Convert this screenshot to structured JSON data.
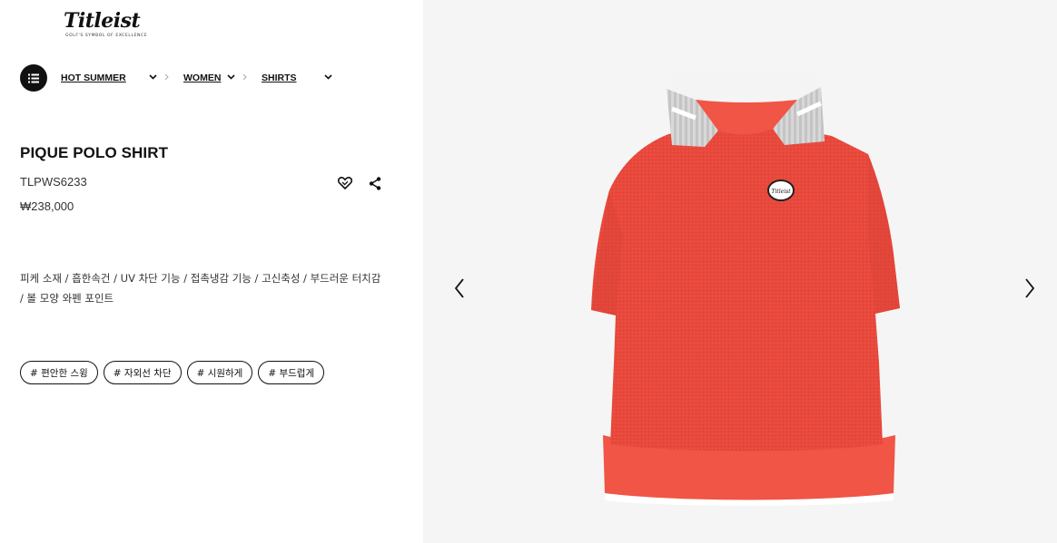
{
  "brand": {
    "name": "Titleist",
    "tagline": "GOLF'S SYMBOL OF EXCELLENCE"
  },
  "breadcrumb": {
    "items": [
      {
        "label": "HOT SUMMER"
      },
      {
        "label": "WOMEN"
      },
      {
        "label": "SHIRTS"
      }
    ]
  },
  "product": {
    "title": "PIQUE POLO SHIRT",
    "code": "TLPWS6233",
    "price": "₩238,000",
    "description": "피케 소재 / 흡한속건 / UV 차단 기능 / 접촉냉감 기능 / 고신축성 / 부드러운 터치감 / 볼 모양 와펜 포인트",
    "tags": [
      "# 편안한 스윙",
      "# 자외선 차단",
      "# 시원하게",
      "# 부드럽게"
    ],
    "color": "#e8493c",
    "patch_text": "Titleist"
  },
  "icons": {
    "menu": "menu-list-icon",
    "wishlist": "heart-icon",
    "share": "share-icon",
    "prev": "chevron-left-icon",
    "next": "chevron-right-icon"
  }
}
